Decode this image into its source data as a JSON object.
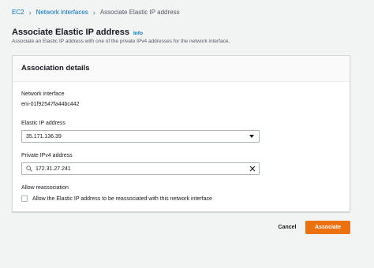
{
  "breadcrumb": {
    "items": [
      "EC2",
      "Network interfaces"
    ],
    "current": "Associate Elastic IP address"
  },
  "header": {
    "title": "Associate Elastic IP address",
    "info": "Info",
    "description": "Associate an Elastic IP address with one of the private IPv4 addresses for the network interface."
  },
  "panel": {
    "title": "Association details",
    "network_interface": {
      "label": "Network interface",
      "value": "eni-01f92547fa44bc442"
    },
    "elastic_ip": {
      "label": "Elastic IP address",
      "value": "35.171.136.39"
    },
    "private_ip": {
      "label": "Private IPv4 address",
      "value": "172.31.27.241"
    },
    "reassociation": {
      "label": "Allow reassociation",
      "checkbox_label": "Allow the Elastic IP address to be reassociated with this network interface",
      "checked": false
    }
  },
  "actions": {
    "cancel": "Cancel",
    "associate": "Associate"
  },
  "colors": {
    "link": "#0073bb",
    "primary_button": "#ec7211",
    "background": "#f2f3f3"
  },
  "icons": {
    "breadcrumb_separator": "chevron-right-icon",
    "dropdown": "caret-down-icon",
    "search": "search-icon",
    "clear": "close-icon"
  }
}
